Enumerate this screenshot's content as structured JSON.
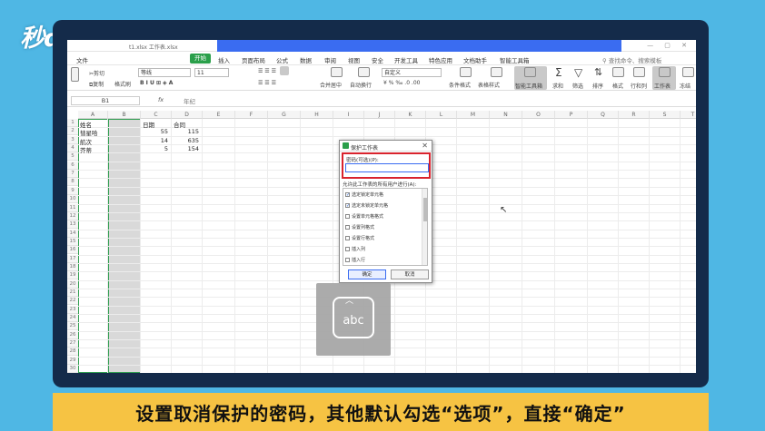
{
  "brand": {
    "logo_text": "秒dong视频"
  },
  "caption": "设置取消保护的密码，其他默认勾选“选项”，直接“确定”",
  "titlebar": {
    "file_name": "t1.xlsx 工作表.xlsx"
  },
  "menubar": {
    "start_label": "开始",
    "items": [
      "文件",
      "插入",
      "页面布局",
      "公式",
      "数据",
      "审阅",
      "视图",
      "安全",
      "开发工具",
      "特色应用",
      "文档助手",
      "智能工具箱"
    ],
    "search_text": "查找命令、搜索模板"
  },
  "ribbon": {
    "cut": "剪切",
    "copy": "复制",
    "format_painter": "格式刷",
    "font_name": "等线",
    "font_size": "11",
    "merge": "合并居中",
    "wrap": "自动换行",
    "number_format": "自定义",
    "cond_format": "条件格式",
    "table_style": "表格样式",
    "smart_toolbox": "智能工具箱",
    "sum": "求和",
    "filter": "筛选",
    "sort": "排序",
    "format": "格式",
    "rowcol": "行和列",
    "worksheet": "工作表",
    "freeze": "冻结"
  },
  "formula_bar": {
    "name_box": "B1",
    "fx": "fx",
    "value": "年纪"
  },
  "grid": {
    "columns": [
      "A",
      "B",
      "C",
      "D",
      "E",
      "F",
      "G",
      "H",
      "I",
      "J",
      "K",
      "L",
      "M",
      "N",
      "O",
      "P",
      "Q",
      "R",
      "S",
      "T"
    ],
    "rows": [
      "1",
      "2",
      "3",
      "4",
      "5",
      "6",
      "7",
      "8",
      "9",
      "10",
      "11",
      "12",
      "13",
      "14",
      "15",
      "16",
      "17",
      "18",
      "19",
      "20",
      "21",
      "22",
      "23",
      "24",
      "25",
      "26",
      "27",
      "28",
      "29",
      "30"
    ],
    "cells": {
      "A1": "姓名",
      "C1": "日期",
      "D1": "合同",
      "A2": "彗星哈",
      "C2": "55",
      "D2": "115",
      "A3": "航次",
      "C3": "14",
      "D3": "635",
      "A4": "芥蒂",
      "C4": "5",
      "D4": "154"
    }
  },
  "dialog": {
    "title": "保护工作表",
    "password_label": "密码(可选)(P):",
    "allow_label": "允许此工作表的所有用户进行(A):",
    "options": [
      {
        "label": "选定锁定单元格",
        "checked": true
      },
      {
        "label": "选定未锁定单元格",
        "checked": true
      },
      {
        "label": "设置单元格格式",
        "checked": false
      },
      {
        "label": "设置列格式",
        "checked": false
      },
      {
        "label": "设置行格式",
        "checked": false
      },
      {
        "label": "插入列",
        "checked": false
      },
      {
        "label": "插入行",
        "checked": false
      }
    ],
    "ok_label": "确定",
    "cancel_label": "取消"
  },
  "keyboard_hint": {
    "text": "abc"
  }
}
